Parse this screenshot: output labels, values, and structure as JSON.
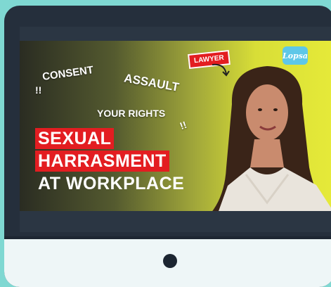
{
  "thumbnail": {
    "words": {
      "consent": "CONSENT",
      "assault": "ASSAULT",
      "rights": "YOUR RIGHTS",
      "bang1": "!!",
      "bang2": "!!"
    },
    "headline": [
      "SEXUAL",
      "HARRASMENT",
      "AT WORKPLACE"
    ],
    "badge": "LAWYER",
    "logo": "Lopsa"
  },
  "colors": {
    "background": "#7fd8d2",
    "monitor": "#252f3c",
    "accent_red": "#e31d21",
    "screen_yellow": "#e6ea39"
  }
}
